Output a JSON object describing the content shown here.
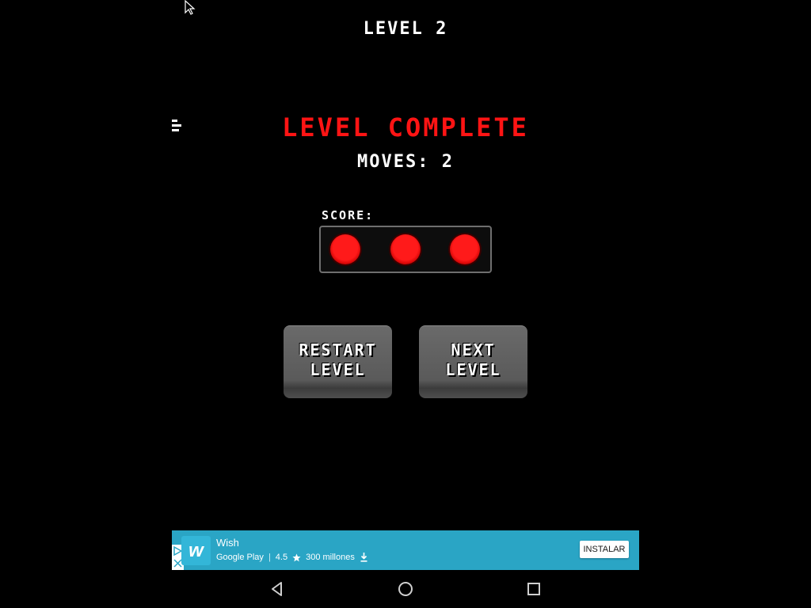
{
  "game": {
    "level_title": "LEVEL 2",
    "complete_title": "LEVEL COMPLETE",
    "moves_text": "MOVES: 2",
    "score_label": "SCORE:",
    "score_dots_filled": 3,
    "score_dots_total": 3,
    "dot_color": "#ff1414",
    "title_color": "#ff1414"
  },
  "buttons": {
    "restart_line1": "RESTART",
    "restart_line2": "LEVEL",
    "next_line1": "NEXT",
    "next_line2": "LEVEL"
  },
  "ad": {
    "app_name": "Wish",
    "store": "Google Play",
    "rating": "4.5",
    "downloads": "300 millones",
    "install_label": "INSTALAR",
    "logo_letter": "w",
    "background_color": "#2aa5c5"
  },
  "navbar": {
    "icons": [
      "back-icon",
      "home-icon",
      "recents-icon"
    ]
  }
}
